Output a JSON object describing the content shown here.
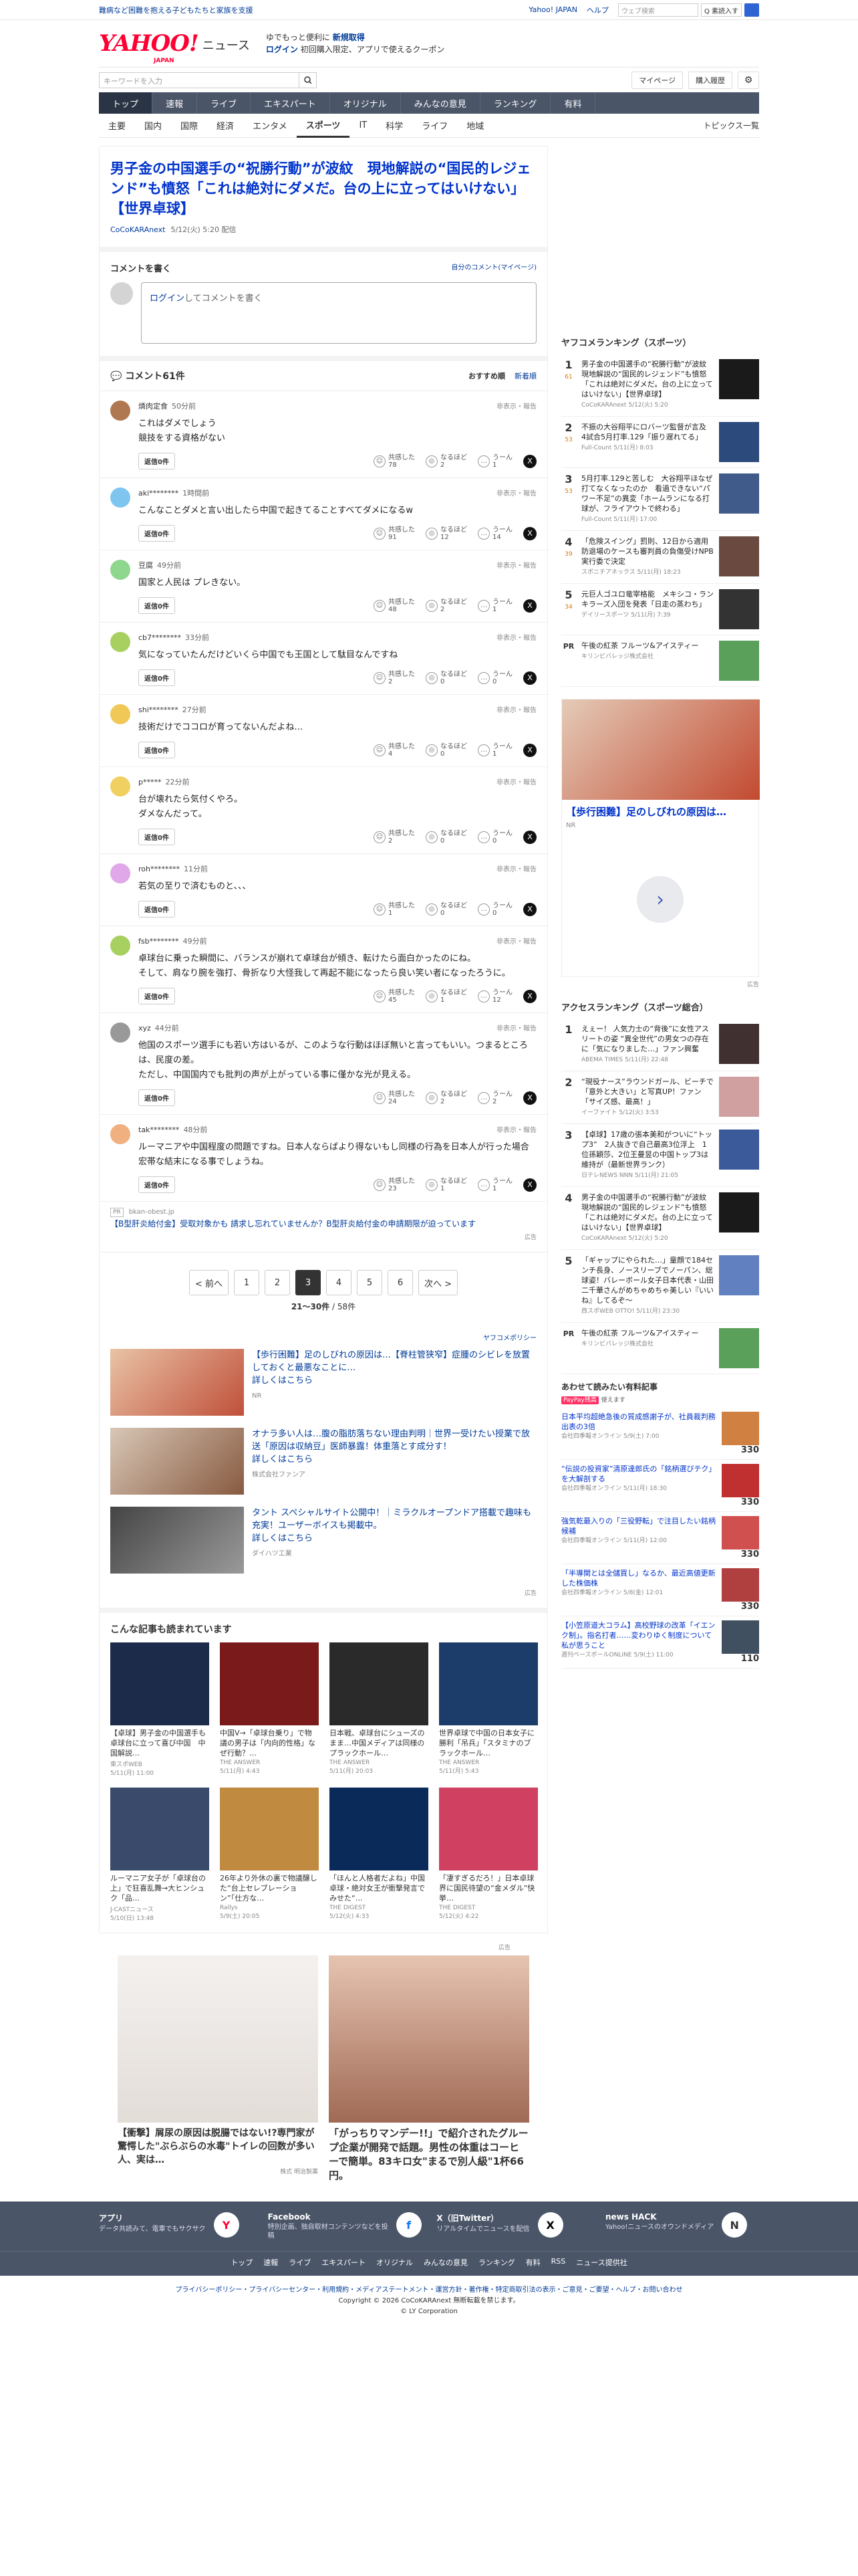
{
  "topbar": {
    "tagline": "難病など困難を抱える子どもたちと家族を支援",
    "links": [
      "Yahoo! JAPAN",
      "ヘルプ"
    ],
    "search_placeholder": "ウェブ検索",
    "search_btn": "Q 素読入す"
  },
  "header": {
    "logo": "YAHOO!",
    "logo_sub": "JAPAN",
    "news": "ニュース",
    "promo_l1a": "ゆでもっと便利に",
    "promo_l1b": "新規取得",
    "promo_l2a": "ログイン",
    "promo_l2b": "初回購入限定、アプリで使えるクーポン"
  },
  "search": {
    "placeholder": "キーワードを入力",
    "mypage": "マイページ",
    "purchase": "購入履歴"
  },
  "mainnav": [
    "トップ",
    "速報",
    "ライブ",
    "エキスパート",
    "オリジナル",
    "みんなの意見",
    "ランキング",
    "有料"
  ],
  "subnav": [
    "主要",
    "国内",
    "国際",
    "経済",
    "エンタメ",
    "スポーツ",
    "IT",
    "科学",
    "ライフ",
    "地域"
  ],
  "subnav_right": "トピックス一覧",
  "article": {
    "title": "男子金の中国選手の“祝勝行動”が波紋　現地解説の“国民的レジェンド”も憤怒「これは絶対にダメだ。台の上に立ってはいけない」【世界卓球】",
    "source": "CoCoKARAnext",
    "date": "5/12(火) 5:20 配信"
  },
  "comment_form": {
    "title": "コメントを書く",
    "mine": "自分のコメント(マイページ)",
    "login": "ログイン",
    "rest": "してコメントを書く"
  },
  "comments_head": {
    "title": "コメント61件",
    "sort1": "おすすめ順",
    "sort2": "新着順"
  },
  "comments": [
    {
      "user": "燐肉定食",
      "time": "50分前",
      "text": "これはダメでしょう\n競技をする資格がない",
      "reply": "返信0件",
      "k": "78",
      "n": "2",
      "u": "1",
      "color": "#b07850"
    },
    {
      "user": "aki********",
      "time": "1時間前",
      "text": "こんなことダメと言い出したら中国で起きてることすべてダメになるw",
      "reply": "返信0件",
      "k": "91",
      "n": "12",
      "u": "14",
      "color": "#7ec5f0"
    },
    {
      "user": "豆腐",
      "time": "49分前",
      "text": "国家と人民は プレきない。",
      "reply": "返信0件",
      "k": "48",
      "n": "2",
      "u": "1",
      "color": "#8fd68f"
    },
    {
      "user": "cb7********",
      "time": "33分前",
      "text": "気になっていたんだけどいくら中国でも王国として駄目なんですね",
      "reply": "返信0件",
      "k": "2",
      "n": "0",
      "u": "0",
      "color": "#a8d060"
    },
    {
      "user": "shi********",
      "time": "27分前",
      "text": "技術だけでココロが育ってないんだよね…",
      "reply": "返信0件",
      "k": "4",
      "n": "0",
      "u": "1",
      "color": "#f0c858"
    },
    {
      "user": "p*****",
      "time": "22分前",
      "text": "台が壊れたら気付くやろ。\nダメなんだって。",
      "reply": "返信0件",
      "k": "2",
      "n": "0",
      "u": "0",
      "color": "#f0d060"
    },
    {
      "user": "roh********",
      "time": "11分前",
      "text": "若気の至りで済むものと、、、",
      "reply": "返信0件",
      "k": "1",
      "n": "0",
      "u": "0",
      "color": "#e0a8e8"
    },
    {
      "user": "fsb********",
      "time": "49分前",
      "text": "卓球台に乗った瞬間に、バランスが崩れて卓球台が傾き、転けたら面白かったのにね。\nそして、肩なり腕を強打、骨折なり大怪我して再起不能になったら良い笑い者になったろうに。",
      "reply": "返信0件",
      "k": "45",
      "n": "1",
      "u": "12",
      "color": "#a8d060"
    },
    {
      "user": "xyz",
      "time": "44分前",
      "text": "他国のスポーツ選手にも若い方はいるが、このような行動はほぼ無いと言ってもいい。つまるところは、民度の差。\nただし、中国国内でも批判の声が上がっている事に僅かな光が見える。",
      "reply": "返信0件",
      "k": "24",
      "n": "2",
      "u": "2",
      "color": "#999"
    },
    {
      "user": "tak********",
      "time": "48分前",
      "text": "ルーマニアや中国程度の問題ですね。日本人ならばより得ないもし同様の行為を日本人が行った場合宏帯な結末になる事でしょうね。",
      "reply": "返信0件",
      "k": "23",
      "n": "1",
      "u": "1",
      "color": "#f0b080"
    }
  ],
  "react_labels": {
    "k": "共感した",
    "n": "なるほど",
    "u": "うーん"
  },
  "report": "非表示・報告",
  "inline_ad": {
    "src": "bkan-obest.jp",
    "title": "【B型肝炎給付金】受取対象かも 請求し忘れていませんか？B型肝炎給付金の申請期限が迫っています",
    "tag": "広告"
  },
  "pager": {
    "prev": "< 前へ",
    "pages": [
      "1",
      "2",
      "3",
      "4",
      "5",
      "6"
    ],
    "active": "3",
    "next": "次へ >",
    "count": "21〜30件",
    "total": "/ 58件"
  },
  "adlist": {
    "policy": "ヤフコメポリシー",
    "items": [
      {
        "title": "【歩行困難】足のしびれの原因は…【脊柱管狭窄】症腫のシビレを放置しておくと最悪なことに…",
        "link": "詳しくはこちら",
        "sp": "NR"
      },
      {
        "title": "オナラ多い人は…腹の脂肪落ちない理由判明｜世界一受けたい授業で放送「原因は収納豆」医師暴露！体重落とす成分す！",
        "link": "詳しくはこちら",
        "sp": "株式会社ファンア"
      },
      {
        "title": "タント スペシャルサイト公開中！｜ミラクルオープンドア搭載で趣味も充実！ユーザーボイスも掲載中。",
        "link": "詳しくはこちら",
        "sp": "ダイハツ工業"
      }
    ],
    "tag": "広告"
  },
  "more": {
    "title": "こんな記事も読まれています",
    "items": [
      {
        "t": "【卓球】男子金の中国選手も卓球台に立って喜び中国　中国解説…",
        "s": "東スポWEB",
        "d": "5/11(月) 11:00"
      },
      {
        "t": "中国V→「卓球台乗り」で物議の男子は「内向的性格」なぜ行動？…",
        "s": "THE ANSWER",
        "d": "5/11(月) 4:43"
      },
      {
        "t": "日本戦、卓球台にシューズのまま…中国メディアは同様のプラックホール…",
        "s": "THE ANSWER",
        "d": "5/11(月) 20:03"
      },
      {
        "t": "世界卓球で中国の日本女子に勝利「吊兵」「スタミナのブラックホール…",
        "s": "THE ANSWER",
        "d": "5/11(月) 5:43"
      },
      {
        "t": "ルーマニア女子が「卓球台の上」で狂喜乱舞→大ヒンシュク「品…",
        "s": "J-CASTニュース",
        "d": "5/10(日) 13:48"
      },
      {
        "t": "26年より外休の裏で物議醸した“台上セレブレーション”「仕方な…",
        "s": "Rallys",
        "d": "5/9(土) 20:05"
      },
      {
        "t": "「ほんと人格者だよね」中国卓球・絶対女王が衝撃発言でみせた“…",
        "s": "THE DIGEST",
        "d": "5/12(火) 4:33"
      },
      {
        "t": "「凄すぎるだろ！」日本卓球界に国民待望の“金メダル”快挙…",
        "s": "THE DIGEST",
        "d": "5/12(火) 4:22"
      }
    ]
  },
  "bottom_ads": {
    "tag": "広告",
    "a1": "【衝撃】屑尿の原因は脱腸ではない!?専門家が驚愕した\"ぶらぶらの水毒\"トイレの回数が多い人、実は…",
    "a1s": "株式 明治製薬",
    "a2": "「がっちりマンデー!!」で紹介されたグループ企業が開発で話題。男性の体重はコーヒーで簡単。83キロ女\"まるで別人級\"1杯66円。"
  },
  "side_rank1": {
    "title": "ヤフコメランキング（スポーツ）",
    "items": [
      {
        "n": "1",
        "c": "61",
        "t": "男子金の中国選手の“祝勝行動”が波紋　現地解説の“国民的レジェンド”も憤怒「これは絶対にダメだ。台の上に立ってはいけない」【世界卓球】",
        "s": "CoCoKARAnext 5/12(火) 5:20"
      },
      {
        "n": "2",
        "c": "53",
        "t": "不振の大谷翔平にロバーツ監督が言及　4試合5月打率.129「振り遅れてる」",
        "s": "Full-Count 5/11(月) 8:03"
      },
      {
        "n": "3",
        "c": "53",
        "t": "5月打率.129と苦しむ　大谷翔平ほなぜ打てなくなったのか　看過できない“パワー不足”の異変「ホームランになる打球が、フライアウトで終わる」",
        "s": "Full-Count 5/11(月) 17:00"
      },
      {
        "n": "4",
        "c": "39",
        "t": "「危険スイング」罰則、12日から適用　防退場のケースも審判員の負傷受けNPB実行委で決定",
        "s": "スポニチアネックス 5/11(月) 18:23"
      },
      {
        "n": "5",
        "c": "34",
        "t": "元巨人ゴユロ竜宰格能　メキシコ・ランキラーズ入団を発表「日走の蒸わち」",
        "s": "デイリースポーツ 5/11(月) 7:39"
      },
      {
        "n": "PR",
        "c": "",
        "t": "午後の紅茶 フルーツ&アイスティー",
        "s": "キリンビバレッジ株式会社"
      }
    ]
  },
  "side_ad": {
    "title": "【歩行困難】足のしびれの原因は…",
    "sp": "NR",
    "tag": "広告"
  },
  "side_rank2": {
    "title": "アクセスランキング（スポーツ総合）",
    "items": [
      {
        "n": "1",
        "t": "えぇー！ 人気力士の“背後”に女性アスリートの姿 “異全世代”の男女つの存在に「気になりました…」ファン興奮",
        "s": "ABEMA TIMES 5/11(月) 22:48"
      },
      {
        "n": "2",
        "t": "“現役ナース”ラウンドガール、ビーチで「意外と大きい」と写真UP！ファン「サイズ感、最高！」",
        "s": "イーファイト 5/12(火) 3:53"
      },
      {
        "n": "3",
        "t": "【卓球】17歳の張本美和がついに“トップ3”　2人抜きで自己最高3位浮上　1位孫穎莎、2位王曼昱の中国トップ3は維持が（最新世界ランク）",
        "s": "日テレNEWS NNN 5/11(月) 21:05"
      },
      {
        "n": "4",
        "t": "男子金の中国選手の“祝勝行動”が波紋　現地解説の“国民的レジェンド”も憤怒「これは絶対にダメだ。台の上に立ってはいけない」【世界卓球】",
        "s": "CoCoKARAnext 5/12(火) 5:20"
      },
      {
        "n": "5",
        "t": "「ギャップにやられた…」童顔で184センチ長身、ノースリーブでノーパン、総球姿！バレーボール女子日本代表・山田二千華さんがめちゃめちゃ美しい『いいね』してるぞ～",
        "s": "西スポWEB OTTO! 5/11(月) 23:30"
      },
      {
        "n": "PR",
        "t": "午後の紅茶 フルーツ&アイスティー",
        "s": "キリンビバレッジ株式会社"
      }
    ]
  },
  "paid": {
    "title": "あわせて読みたい有料記事",
    "sub_badge": "PayPay残高",
    "sub_text": "使えます",
    "items": [
      {
        "t": "日本平均超絶急後の質成感謝子が、社員裁判務出表の3倍",
        "s": "会社四季報オンライン 5/9(土) 7:00",
        "p": "330"
      },
      {
        "t": "“伝説の投資家”清原達郎氏の「銘柄選びテク」を大解剖する",
        "s": "会社四季報オンライン 5/11(月) 18:30",
        "p": "330"
      },
      {
        "t": "強気乾最入りの「三役野転」で注目したい銘柄候補",
        "s": "会社四季報オンライン 5/11(月) 12:00",
        "p": "330"
      },
      {
        "t": "「半導関とは全儲買し」なるか、最近高値更新した株価株",
        "s": "会社四季報オンライン 5/8(金) 12:01",
        "p": "330"
      },
      {
        "t": "【小笠原道大コラム】高校野球の改革「イエンク制」。指名打者……変わりゆく制度について私が思うこと",
        "s": "週刊ベースボールONLINE 5/9(土) 11:00",
        "p": "110"
      }
    ]
  },
  "footer": {
    "cols": [
      {
        "t": "アプリ",
        "d": "データ共読みて、電車でもサクサク",
        "i": "Y"
      },
      {
        "t": "Facebook",
        "d": "特別企画、独自取材コンテンツなどを投稿",
        "i": "f"
      },
      {
        "t": "X（旧Twitter）",
        "d": "リアルタイムでニュースを配信",
        "i": "X"
      },
      {
        "t": "news HACK",
        "d": "Yahoo!ニュースのオウンドメディア",
        "i": "N"
      }
    ],
    "links": [
      "トップ",
      "速報",
      "ライブ",
      "エキスパート",
      "オリジナル",
      "みんなの意見",
      "ランキング",
      "有料",
      "RSS",
      "ニュース提供社"
    ],
    "legal1": "プライバシーポリシー・プライバシーセンター・利用規約・メディアステートメント・運営方針・著作権・特定商取引法の表示・ご意見・ご要望・ヘルプ・お問い合わせ",
    "legal2": "Copyright © 2026 CoCoKARAnext 無断転載を禁じます。",
    "legal3": "© LY Corporation"
  }
}
